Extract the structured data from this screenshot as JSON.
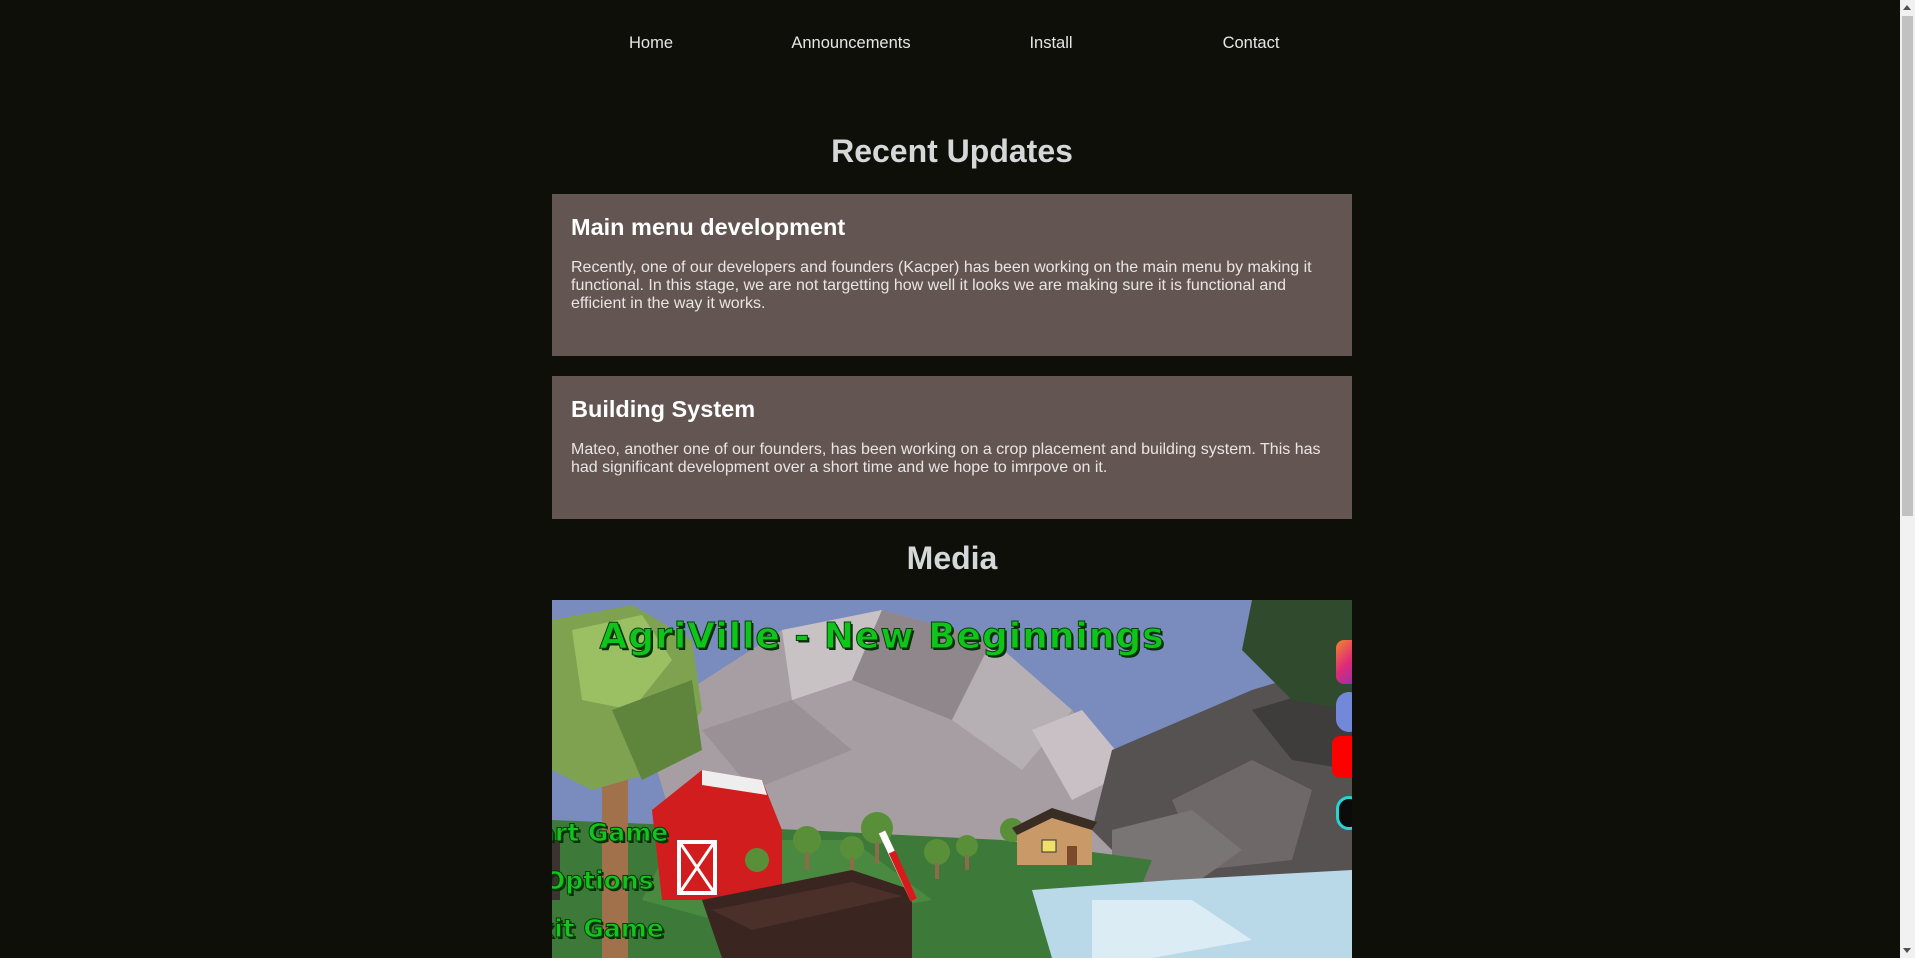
{
  "nav": {
    "items": [
      {
        "label": "Home"
      },
      {
        "label": "Announcements"
      },
      {
        "label": "Install"
      },
      {
        "label": "Contact"
      }
    ]
  },
  "updates": {
    "heading": "Recent Updates",
    "posts": [
      {
        "title": "Main menu development",
        "body": "Recently, one of our developers and founders (Kacper) has been working on the main menu by making it functional. In this stage, we are not targetting how well it looks we are making sure it is functional and efficient in the way it works."
      },
      {
        "title": "Building System",
        "body": "Mateo, another one of our founders, has been working on a crop placement and building system. This has had significant development over a short time and we hope to imrpove on it."
      }
    ]
  },
  "media": {
    "heading": "Media",
    "screenshot": {
      "game_title": "AgriVille - New Beginnings",
      "menu": [
        "art Game",
        "Options",
        "xit Game"
      ],
      "social_icons": [
        "instagram-icon",
        "discord-icon",
        "youtube-icon",
        "tiktok-icon"
      ]
    }
  },
  "colors": {
    "background": "#0e0f09",
    "card": "#635652",
    "heading": "#d6d7d9",
    "game_green": "#0fc41a"
  }
}
